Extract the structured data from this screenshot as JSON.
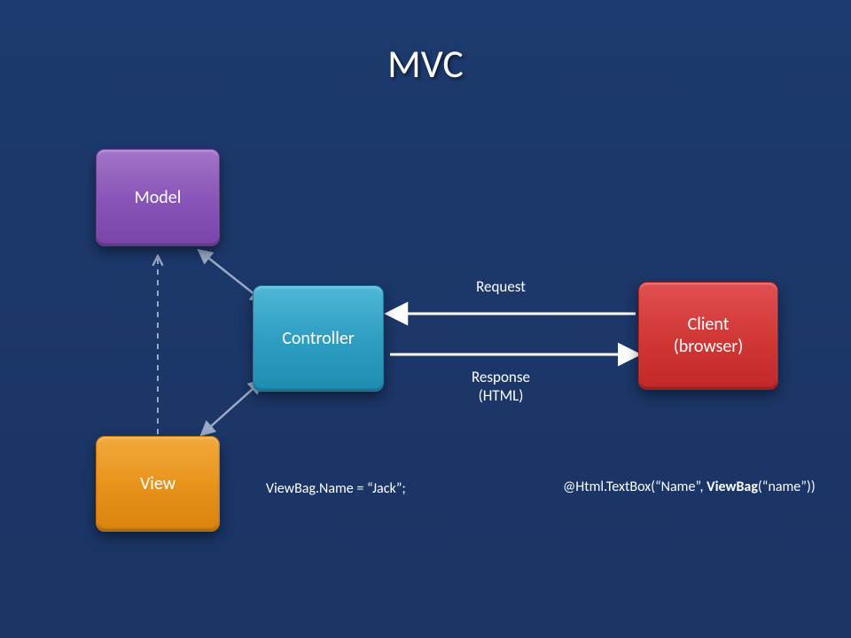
{
  "title": "MVC",
  "boxes": {
    "model": "Model",
    "controller": "Controller",
    "view": "View",
    "client_line1": "Client",
    "client_line2": "(browser)"
  },
  "labels": {
    "request": "Request",
    "response_line1": "Response",
    "response_line2": "(HTML)"
  },
  "code": {
    "snippet1": "ViewBag.Name = “Jack”;",
    "snippet2_prefix": "@Html.TextBox(“Name”, ",
    "snippet2_bold": "ViewBag",
    "snippet2_suffix": "(“name”))"
  }
}
